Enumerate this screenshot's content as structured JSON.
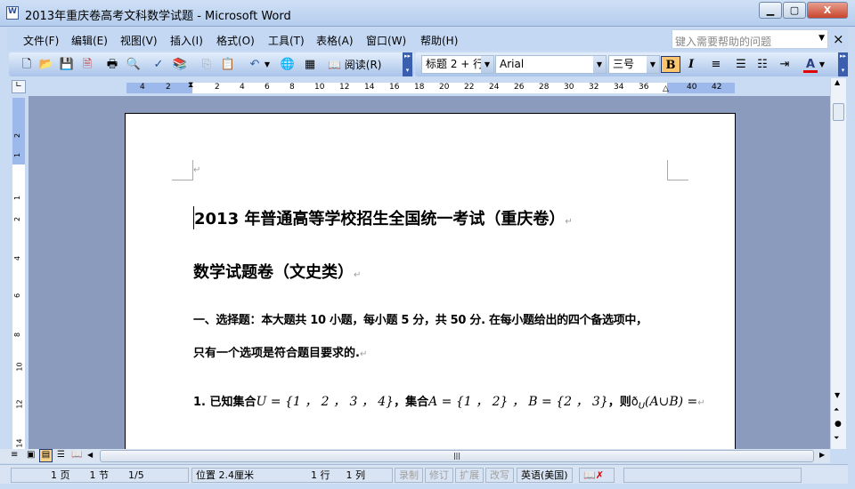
{
  "window": {
    "title": "2013年重庆卷高考文科数学试题 - Microsoft Word",
    "minimize": "▁",
    "restore": "▢",
    "close": "X"
  },
  "menu": [
    "文件(F)",
    "编辑(E)",
    "视图(V)",
    "插入(I)",
    "格式(O)",
    "工具(T)",
    "表格(A)",
    "窗口(W)",
    "帮助(H)"
  ],
  "help": {
    "placeholder": "键入需要帮助的问题",
    "close": "×"
  },
  "toolbar": {
    "read_label": "阅读(R)"
  },
  "format": {
    "style": "标题 2 + 行",
    "font": "Arial",
    "size": "三号",
    "bold": "B",
    "italic": "I",
    "font_color_label": "A",
    "font_color": "#e00000"
  },
  "ruler": {
    "left": [
      "4",
      "2"
    ],
    "main": [
      "2",
      "4",
      "6",
      "8",
      "10",
      "12",
      "14",
      "16",
      "18",
      "20",
      "22",
      "24",
      "26",
      "28",
      "30",
      "32",
      "34",
      "36"
    ],
    "right": [
      "40",
      "42"
    ]
  },
  "vruler": [
    "2",
    "1",
    "1",
    "2",
    "4",
    "6",
    "8",
    "10",
    "12",
    "14"
  ],
  "document": {
    "title": "2013 年普通高等学校招生全国统一考试（重庆卷）",
    "subtitle": "数学试题卷（文史类）",
    "section_line1": "一、选择题：本大题共 10 小题，每小题 5 分，共 50 分. 在每小题给出的四个备选项中，",
    "section_line2": "只有一个选项是符合题目要求的.",
    "q1": "1. 已知集合",
    "q1_math1": "U = {1 ， 2 ， 3 ， 4}",
    "q1_mid": "，集合",
    "q1_math2": "A = {1 ， 2} ， B = {2 ， 3}",
    "q1_then": "，则",
    "q1_math3": "ð",
    "q1_sub": "U",
    "q1_math4": "(A∪B) =",
    "para_mark": "↵"
  },
  "status": {
    "page": "1 页",
    "section": "1 节",
    "pages": "1/5",
    "position": "位置 2.4厘米",
    "line": "1 行",
    "col": "1 列",
    "rec": "录制",
    "trk": "修订",
    "ext": "扩展",
    "ovr": "改写",
    "lang": "英语(美国)"
  }
}
